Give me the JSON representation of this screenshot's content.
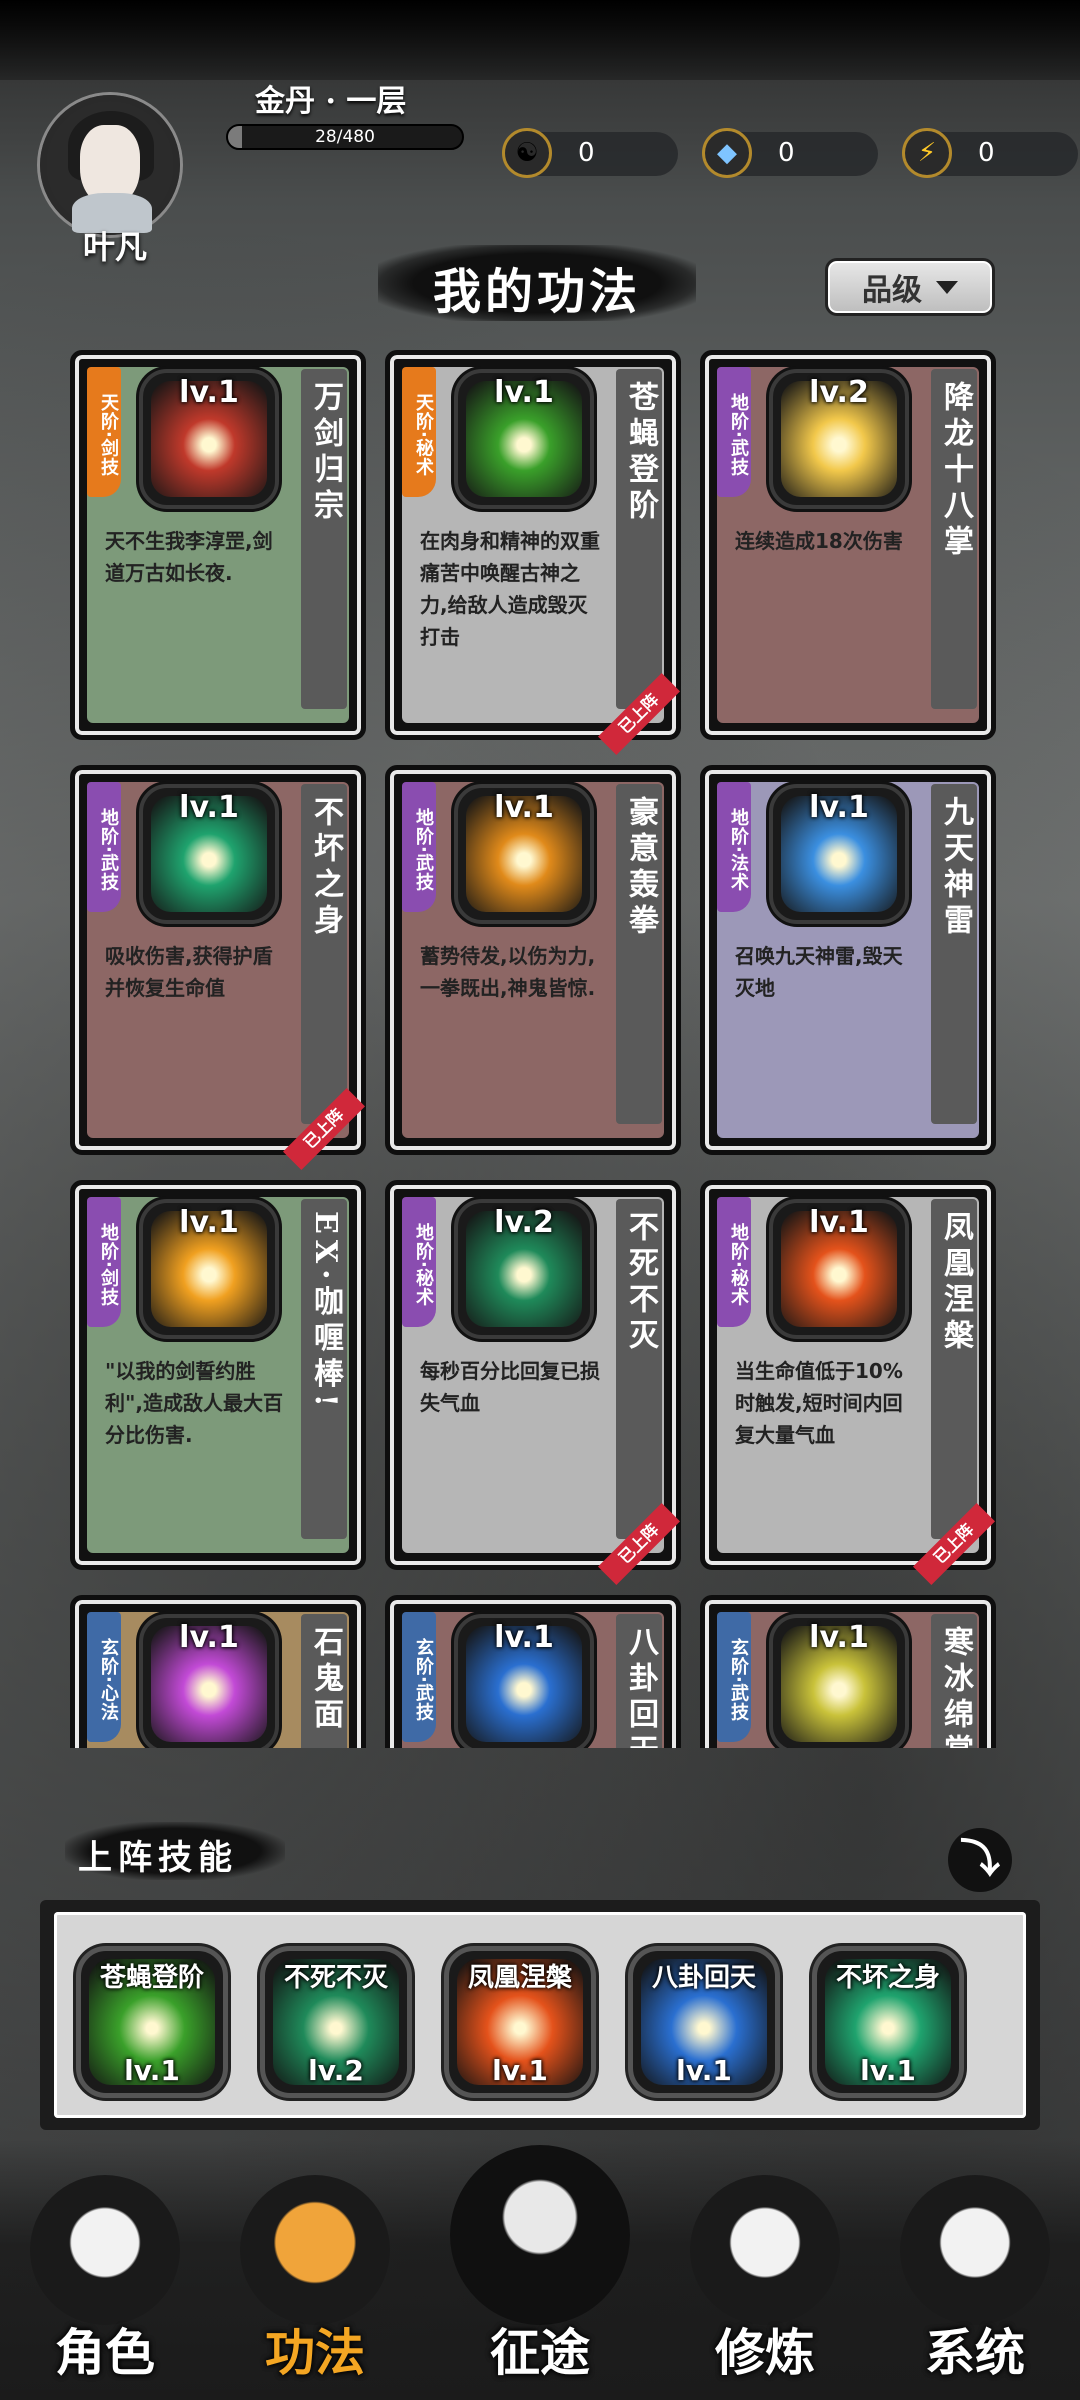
{
  "player": {
    "name": "叶凡",
    "realm": "金丹 · 一层",
    "xp": "28/480",
    "xp_fraction": 0.058
  },
  "resources": [
    {
      "icon": "yin-yang-icon",
      "value": "0"
    },
    {
      "icon": "gem-icon",
      "value": "0"
    },
    {
      "icon": "lightning-icon",
      "value": "0"
    }
  ],
  "page_title": "我的功法",
  "sort_button": "品级",
  "skills": [
    {
      "tier": "天阶·剑技",
      "tier_color": "#e67a1c",
      "level": "lv.1",
      "name": "万剑归宗",
      "desc": "天不生我李淳罡,剑道万古如长夜.",
      "bg": "green",
      "art": "#c0392b",
      "equipped": false
    },
    {
      "tier": "天阶·秘术",
      "tier_color": "#e67a1c",
      "level": "lv.1",
      "name": "苍蝇登阶",
      "desc": "在肉身和精神的双重痛苦中唤醒古神之力,给敌人造成毁灭打击",
      "bg": "gray",
      "art": "#3aa02a",
      "equipped": true,
      "ribbon": "已上阵"
    },
    {
      "tier": "地阶·武技",
      "tier_color": "#8a4db0",
      "level": "lv.2",
      "name": "降龙十八掌",
      "desc": "连续造成18次伤害",
      "bg": "brown",
      "art": "#f2c84b",
      "equipped": false
    },
    {
      "tier": "地阶·武技",
      "tier_color": "#8a4db0",
      "level": "lv.1",
      "name": "不坏之身",
      "desc": "吸收伤害,获得护盾并恢复生命值",
      "bg": "brown",
      "art": "#1fa36e",
      "equipped": true,
      "ribbon": "已上阵"
    },
    {
      "tier": "地阶·武技",
      "tier_color": "#8a4db0",
      "level": "lv.1",
      "name": "豪意轰拳",
      "desc": "蓄势待发,以伤为力,一拳既出,神鬼皆惊.",
      "bg": "brown",
      "art": "#e08a1a",
      "equipped": false
    },
    {
      "tier": "地阶·法术",
      "tier_color": "#8a4db0",
      "level": "lv.1",
      "name": "九天神雷",
      "desc": "召唤九天神雷,毁天灭地",
      "bg": "lav",
      "art": "#3b8fe0",
      "equipped": false
    },
    {
      "tier": "地阶·剑技",
      "tier_color": "#8a4db0",
      "level": "lv.1",
      "name": "EX·咖喱棒!",
      "desc": "\"以我的剑誓约胜利\",造成敌人最大百分比伤害.",
      "bg": "green",
      "art": "#f0a020",
      "equipped": false
    },
    {
      "tier": "地阶·秘术",
      "tier_color": "#8a4db0",
      "level": "lv.2",
      "name": "不死不灭",
      "desc": "每秒百分比回复已损失气血",
      "bg": "gray",
      "art": "#1f8a5a",
      "equipped": true,
      "ribbon": "已上阵"
    },
    {
      "tier": "地阶·秘术",
      "tier_color": "#8a4db0",
      "level": "lv.1",
      "name": "凤凰涅槃",
      "desc": "当生命值低于10%时触发,短时间内回复大量气血",
      "bg": "gray",
      "art": "#e4521b",
      "equipped": true,
      "ribbon": "已上阵"
    },
    {
      "tier": "玄阶·心法",
      "tier_color": "#3f6aa6",
      "level": "lv.1",
      "name": "石鬼面",
      "desc": "",
      "bg": "tan",
      "art": "#c24ad6",
      "equipped": false
    },
    {
      "tier": "玄阶·武技",
      "tier_color": "#3f6aa6",
      "level": "lv.1",
      "name": "八卦回天",
      "desc": "",
      "bg": "brown",
      "art": "#2a6fd0",
      "equipped": false
    },
    {
      "tier": "玄阶·武技",
      "tier_color": "#3f6aa6",
      "level": "lv.1",
      "name": "寒冰绵掌",
      "desc": "",
      "bg": "brown",
      "art": "#c9c23a",
      "equipped": false
    }
  ],
  "equipped_title": "上阵技能",
  "equipped": [
    {
      "name": "苍蝇登阶",
      "level": "lv.1",
      "art": "#3aa02a"
    },
    {
      "name": "不死不灭",
      "level": "lv.2",
      "art": "#1f8a5a"
    },
    {
      "name": "凤凰涅槃",
      "level": "lv.1",
      "art": "#e4521b"
    },
    {
      "name": "八卦回天",
      "level": "lv.1",
      "art": "#2a6fd0"
    },
    {
      "name": "不坏之身",
      "level": "lv.1",
      "art": "#1fa36e"
    }
  ],
  "nav": [
    {
      "label": "角色",
      "icon": "character-icon",
      "active": false
    },
    {
      "label": "功法",
      "icon": "skill-book-icon",
      "active": true
    },
    {
      "label": "征途",
      "icon": "sword-emblem-icon",
      "active": false
    },
    {
      "label": "修炼",
      "icon": "meditation-icon",
      "active": false
    },
    {
      "label": "系统",
      "icon": "system-icon",
      "active": false
    }
  ]
}
